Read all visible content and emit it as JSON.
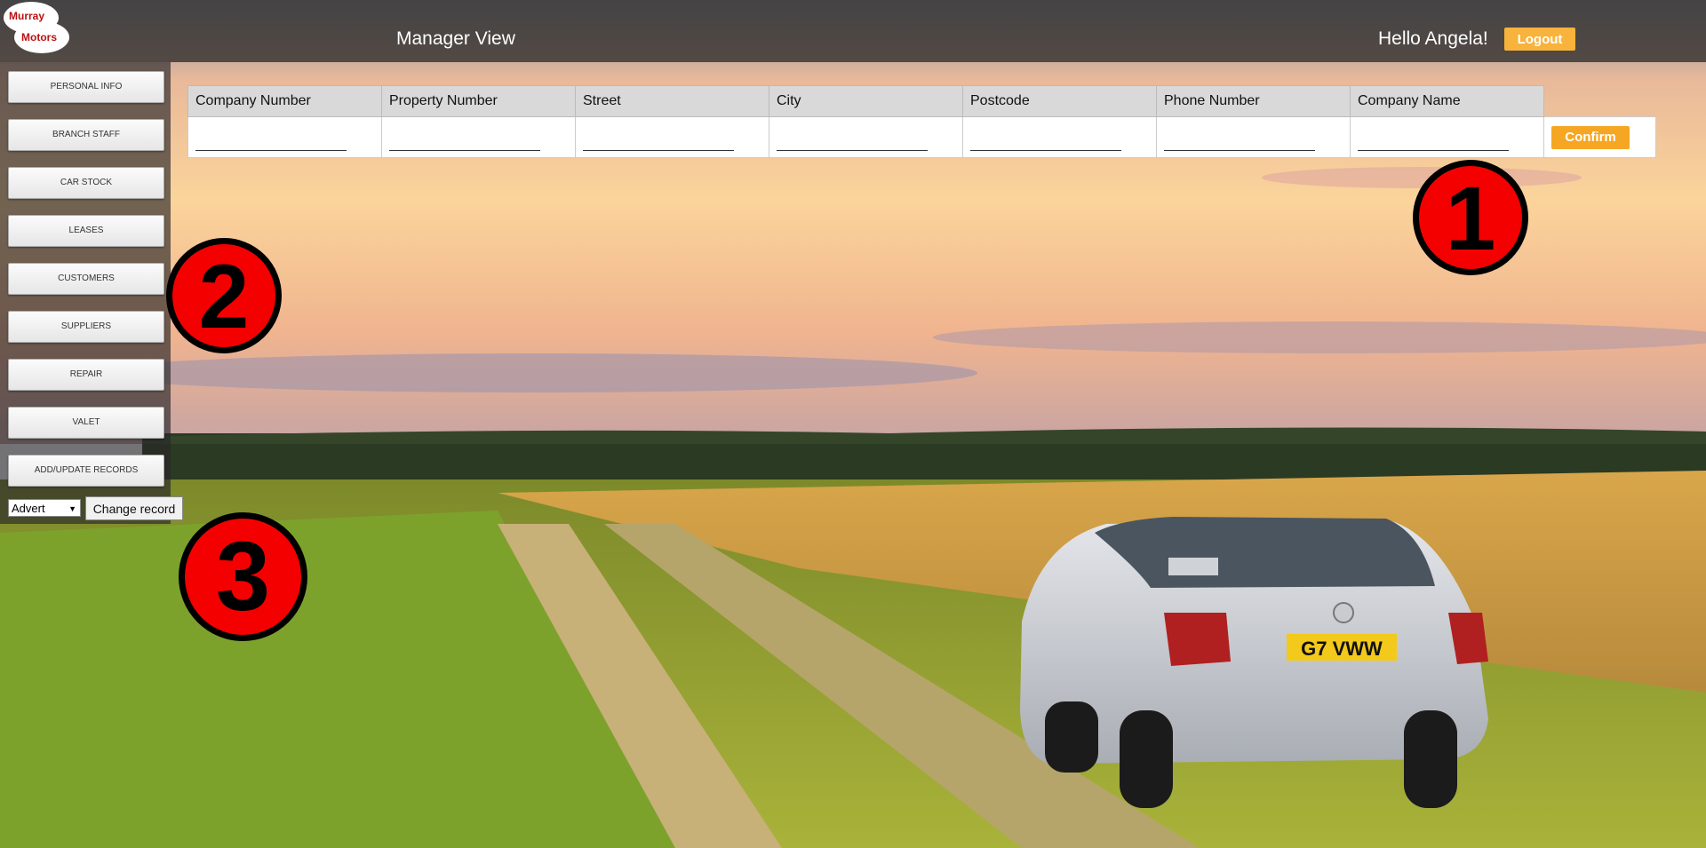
{
  "header": {
    "logo_line1": "Murray",
    "logo_line2": "Motors",
    "title": "Manager View",
    "greeting": "Hello Angela!",
    "logout_label": "Logout"
  },
  "sidebar": {
    "items": [
      {
        "label": "PERSONAL INFO"
      },
      {
        "label": "BRANCH STAFF"
      },
      {
        "label": "CAR STOCK"
      },
      {
        "label": "LEASES"
      },
      {
        "label": "CUSTOMERS"
      },
      {
        "label": "SUPPLIERS"
      },
      {
        "label": "REPAIR"
      },
      {
        "label": "VALET"
      },
      {
        "label": "ADD/UPDATE RECORDS"
      }
    ],
    "record_select_value": "Advert",
    "change_record_label": "Change record"
  },
  "form": {
    "columns": [
      "Company Number",
      "Property Number",
      "Street",
      "City",
      "Postcode",
      "Phone Number",
      "Company Name"
    ],
    "confirm_label": "Confirm"
  },
  "markers": [
    "1",
    "2",
    "3"
  ],
  "scene": {
    "plate_text": "G7 VWW"
  },
  "colors": {
    "accent": "#f5a623",
    "marker": "#f40000"
  }
}
